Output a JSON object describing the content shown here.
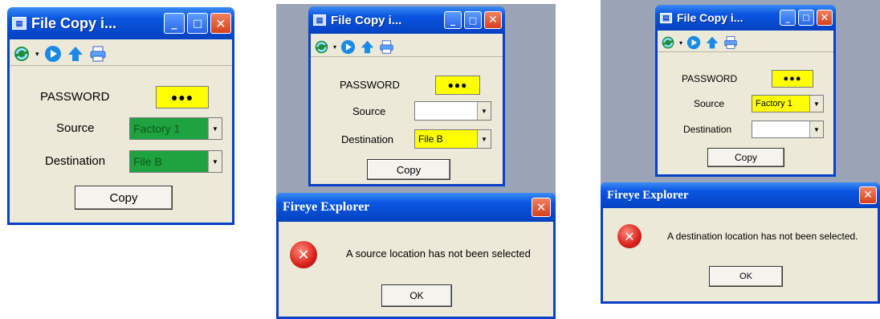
{
  "window_title": "File Copy i...",
  "password_label": "PASSWORD",
  "password_mask": "●●●",
  "source_label": "Source",
  "destination_label": "Destination",
  "copy_label": "Copy",
  "colors": {
    "yellow": "#ffff00",
    "green": "#1fa340",
    "white": "#ffffff",
    "xp_blue": "#0a55e0"
  },
  "panel1": {
    "source_value": "Factory 1",
    "destination_value": "File B"
  },
  "panel2": {
    "source_value": "",
    "destination_value": "File B",
    "dialog": {
      "title": "Fireye Explorer",
      "message": "A source location has not been selected",
      "ok": "OK"
    }
  },
  "panel3": {
    "source_value": "Factory 1",
    "destination_value": "",
    "dialog": {
      "title": "Fireye Explorer",
      "message": "A destination location has not been selected.",
      "ok": "OK"
    }
  }
}
